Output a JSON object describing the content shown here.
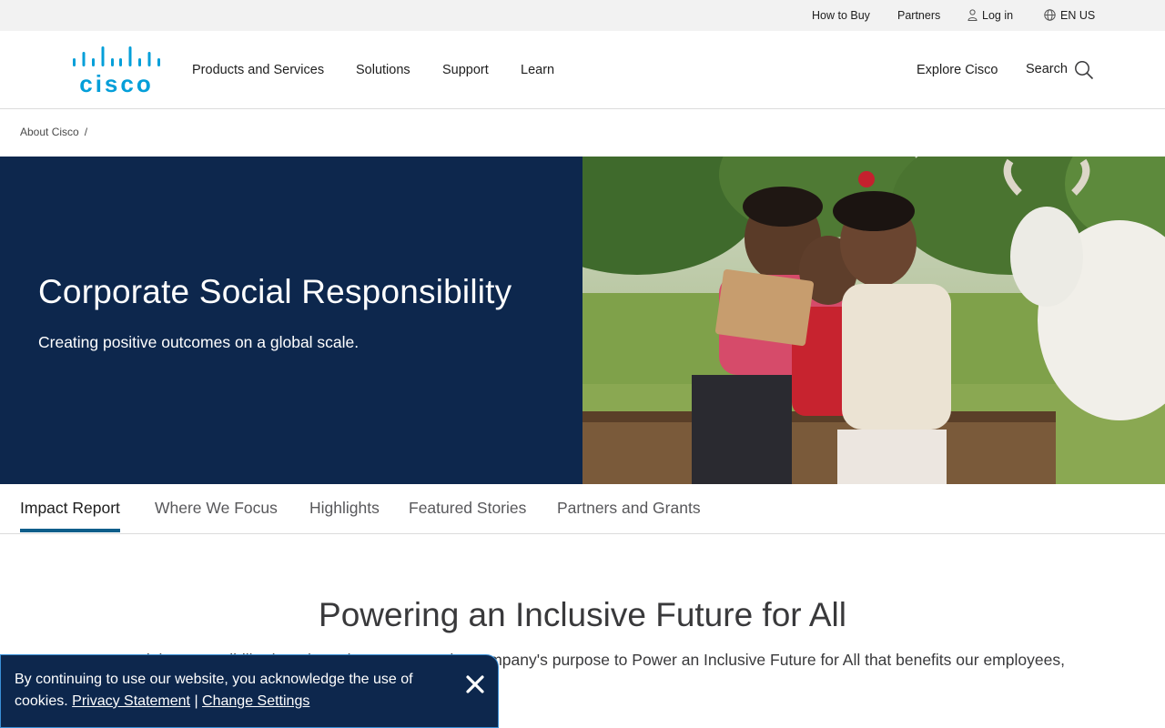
{
  "utility_bar": {
    "how_to_buy": "How to Buy",
    "partners": "Partners",
    "log_in": "Log in",
    "language": "EN US"
  },
  "header": {
    "logo_text": "cisco",
    "nav": [
      "Products and Services",
      "Solutions",
      "Support",
      "Learn"
    ],
    "explore": "Explore Cisco",
    "search": "Search"
  },
  "breadcrumb": {
    "items": [
      "About Cisco"
    ],
    "separator": "/"
  },
  "hero": {
    "title": "Corporate Social Responsibility",
    "subtitle": "Creating positive outcomes on a global scale.",
    "background_color": "#0d274d"
  },
  "tabs": [
    "Impact Report",
    "Where We Focus",
    "Highlights",
    "Featured Stories",
    "Partners and Grants"
  ],
  "section": {
    "title": "Powering an Inclusive Future for All",
    "text": "Corporate Social Responsibility (CSR) at Cisco supports the company's purpose to Power an Inclusive Future for All that benefits our employees, communities, and the planet."
  },
  "cookie": {
    "text": "By continuing to use our website, you acknowledge the use of cookies.",
    "privacy_link": "Privacy Statement",
    "divider": "|",
    "settings_link": "Change Settings"
  },
  "colors": {
    "brand_blue": "#049fd9",
    "navy": "#0d274d",
    "tab_underline": "#0d5e8a"
  }
}
